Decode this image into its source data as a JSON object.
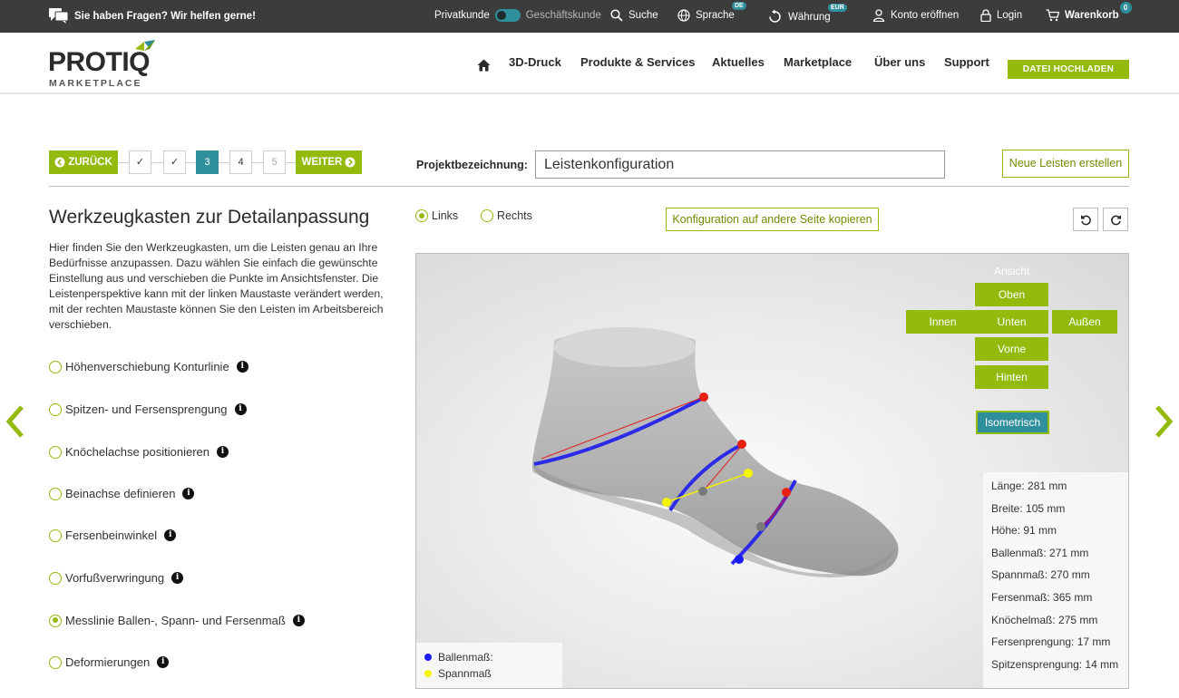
{
  "topbar": {
    "help": "Sie haben Fragen? Wir helfen gerne!",
    "privatkunde": "Privatkunde",
    "geschaeftskunde": "Geschäftskunde",
    "suche": "Suche",
    "sprache": "Sprache",
    "sprache_badge": "DE",
    "waehrung": "Währung",
    "waehrung_badge": "EUR",
    "konto": "Konto eröffnen",
    "login": "Login",
    "warenkorb": "Warenkorb",
    "warenkorb_count": "0"
  },
  "header": {
    "logo_word": "PROTIQ",
    "logo_sub": "MARKETPLACE",
    "nav": [
      "3D-Druck",
      "Produkte & Services",
      "Aktuelles",
      "Marketplace",
      "Über uns",
      "Support"
    ],
    "upload": "DATEI HOCHLADEN"
  },
  "steps": {
    "back": "ZURÜCK",
    "next": "WEITER",
    "items": [
      "✓",
      "✓",
      "3",
      "4",
      "5"
    ],
    "project_label": "Projektbezeichnung:",
    "project_value": "Leistenkonfiguration",
    "new_button": "Neue Leisten erstellen"
  },
  "left": {
    "title": "Werkzeugkasten zur Detailanpassung",
    "description": "Hier finden Sie den Werkzeugkasten, um die Leisten genau an Ihre Bedürfnisse anzupassen. Dazu wählen Sie einfach die gewünschte Einstellung aus und verschieben die Punkte im Ansichtsfenster. Die Leistenperspektive kann mit der linken Maustaste verändert werden, mit der rechten Maustaste können Sie den Leisten im Arbeitsbereich verschieben.",
    "options": [
      {
        "label": "Höhenverschiebung Konturlinie",
        "selected": false
      },
      {
        "label": "Spitzen- und Fersensprengung",
        "selected": false
      },
      {
        "label": "Knöchelachse positionieren",
        "selected": false
      },
      {
        "label": "Beinachse definieren",
        "selected": false
      },
      {
        "label": "Fersenbeinwinkel",
        "selected": false
      },
      {
        "label": "Vorfußverwringung",
        "selected": false
      },
      {
        "label": "Messlinie Ballen-, Spann- und Fersenmaß",
        "selected": true
      },
      {
        "label": "Deformierungen",
        "selected": false
      }
    ],
    "info_glyph": "i"
  },
  "viewer": {
    "side_links": "Links",
    "side_rechts": "Rechts",
    "copy_button": "Konfiguration auf andere Seite kopieren",
    "ansicht_label": "Ansicht",
    "view_buttons": {
      "oben": "Oben",
      "innen": "Innen",
      "unten": "Unten",
      "aussen": "Außen",
      "vorne": "Vorne",
      "hinten": "Hinten",
      "iso": "Isometrisch"
    },
    "measurements": [
      "Länge: 281 mm",
      "Breite: 105 mm",
      "Höhe: 91 mm",
      "Ballenmaß: 271 mm",
      "Spannmaß: 270 mm",
      "Fersenmaß: 365 mm",
      "Knöchelmaß: 275 mm",
      "Fersenprengung: 17 mm",
      "Spitzensprengung: 14 mm"
    ],
    "legend": [
      {
        "label": "Ballenmaß:",
        "color": "#1a1aff"
      },
      {
        "label": "Spannmaß",
        "color": "#f5f500"
      }
    ]
  },
  "colors": {
    "accent_green": "#94ba0e",
    "teal": "#2f8f9a",
    "topbar": "#3c3c3c"
  }
}
